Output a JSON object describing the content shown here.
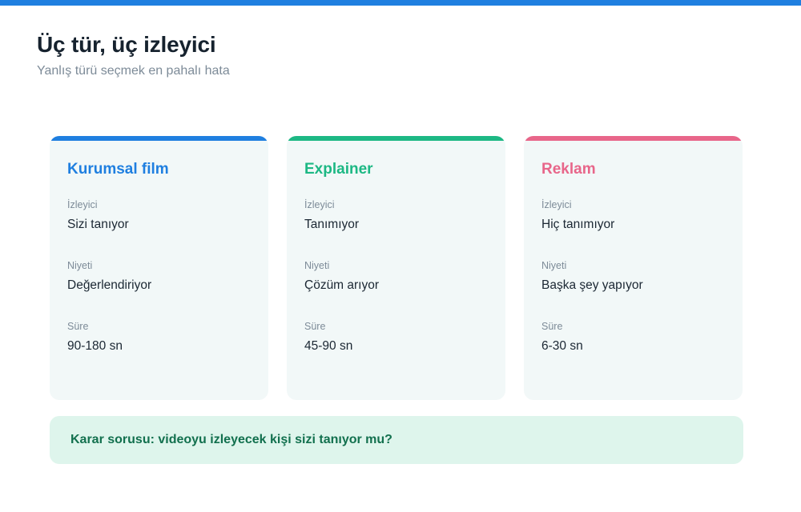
{
  "colors": {
    "top_bar": "#1f7fe0",
    "blue": "#1f7fe0",
    "green": "#1db884",
    "pink": "#e8668a",
    "callout_bg": "#def5ec",
    "callout_text": "#12704e"
  },
  "header": {
    "title": "Üç tür, üç izleyici",
    "subtitle": "Yanlış türü seçmek en pahalı hata"
  },
  "cards": [
    {
      "title": "Kurumsal film",
      "fields": [
        {
          "label": "İzleyici",
          "value": "Sizi tanıyor"
        },
        {
          "label": "Niyeti",
          "value": "Değerlendiriyor"
        },
        {
          "label": "Süre",
          "value": "90-180 sn"
        }
      ]
    },
    {
      "title": "Explainer",
      "fields": [
        {
          "label": "İzleyici",
          "value": "Tanımıyor"
        },
        {
          "label": "Niyeti",
          "value": "Çözüm arıyor"
        },
        {
          "label": "Süre",
          "value": "45-90 sn"
        }
      ]
    },
    {
      "title": "Reklam",
      "fields": [
        {
          "label": "İzleyici",
          "value": "Hiç tanımıyor"
        },
        {
          "label": "Niyeti",
          "value": "Başka şey yapıyor"
        },
        {
          "label": "Süre",
          "value": "6-30 sn"
        }
      ]
    }
  ],
  "callout": {
    "text": "Karar sorusu: videoyu izleyecek kişi sizi tanıyor mu?"
  }
}
